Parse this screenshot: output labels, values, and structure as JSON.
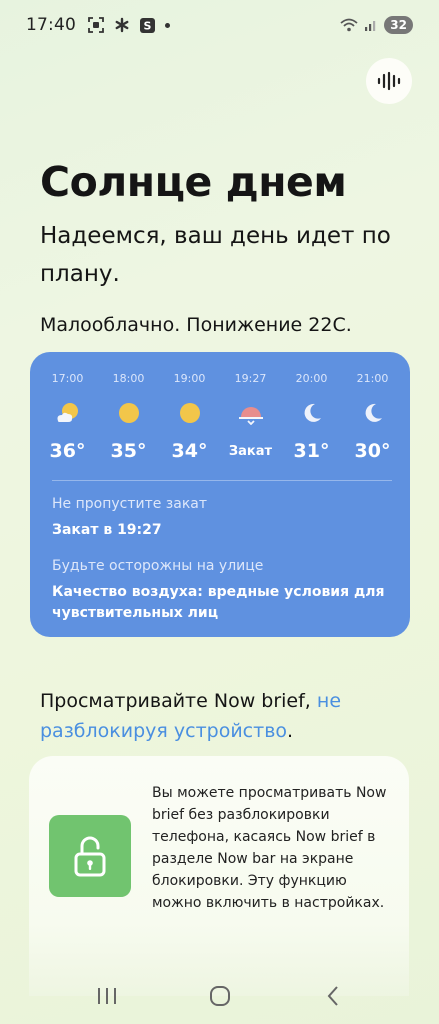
{
  "status_bar": {
    "time": "17:40",
    "battery": "32"
  },
  "header": {
    "title": "Солнце днем",
    "subtitle": "Надеемся, ваш день идет по плану.",
    "summary": "Малооблачно. Понижение 22С."
  },
  "weather": {
    "hours": [
      {
        "time": "17:00",
        "icon": "partly-cloudy-icon",
        "temp": "36°"
      },
      {
        "time": "18:00",
        "icon": "sun-icon",
        "temp": "35°"
      },
      {
        "time": "19:00",
        "icon": "sun-icon",
        "temp": "34°"
      },
      {
        "time": "19:27",
        "icon": "sunset-icon",
        "temp": "Закат"
      },
      {
        "time": "20:00",
        "icon": "moon-icon",
        "temp": "31°"
      },
      {
        "time": "21:00",
        "icon": "moon-icon",
        "temp": "30°"
      }
    ],
    "sunset_label": "Не пропустите закат",
    "sunset_value": "Закат в 19:27",
    "air_label": "Будьте осторожны на улице",
    "air_value": "Качество воздуха: вредные условия для чувствительных лиц",
    "card_color": "#5f91e0"
  },
  "brief": {
    "heading_text": "Просматривайте Now brief, ",
    "heading_link": "не разблокируя устройство",
    "heading_end": ".",
    "card_text": "Вы можете просматривать Now brief без разблокировки телефона, касаясь Now brief в разделе Now bar на экране блокировки. Эту функцию можно включить в настройках.",
    "icon": "unlock-icon",
    "accent": "#71c46f"
  },
  "nav": {
    "recents_icon": "recents-icon",
    "home_icon": "home-icon",
    "back_icon": "back-icon"
  }
}
